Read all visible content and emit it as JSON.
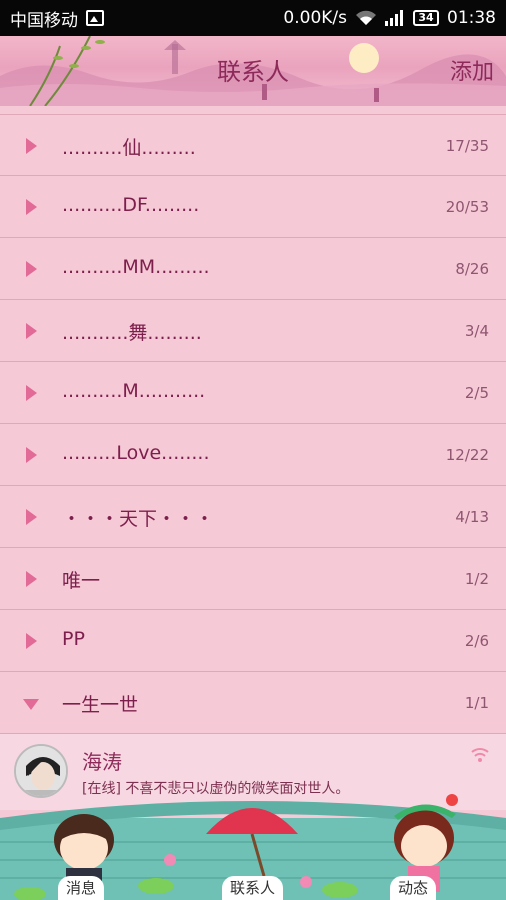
{
  "status_bar": {
    "carrier": "中国移动",
    "net_speed": "0.00K/s",
    "battery": "34",
    "time": "01:38"
  },
  "header": {
    "title": "联系人",
    "add_label": "添加"
  },
  "groups": [
    {
      "name": "..........仙.........",
      "count": "17/35"
    },
    {
      "name": "..........DF.........",
      "count": "20/53"
    },
    {
      "name": "..........MM.........",
      "count": "8/26"
    },
    {
      "name": "...........舞.........",
      "count": "3/4"
    },
    {
      "name": "..........M...........",
      "count": "2/5"
    },
    {
      "name": ".........Love........",
      "count": "12/22"
    },
    {
      "name": "・・・天下・・・",
      "count": "4/13"
    },
    {
      "name": "唯一",
      "count": "1/2"
    },
    {
      "name": "PP",
      "count": "2/6"
    },
    {
      "name": "一生一世",
      "count": "1/1"
    }
  ],
  "contact": {
    "name": "海涛",
    "status": "[在线] 不喜不悲只以虚伪的微笑面对世人。"
  },
  "tabs": {
    "messages": "消息",
    "contacts": "联系人",
    "moments": "动态"
  },
  "colors": {
    "accent": "#8e2a5a",
    "arrow": "#e26a96",
    "background": "#f6c9d6"
  }
}
